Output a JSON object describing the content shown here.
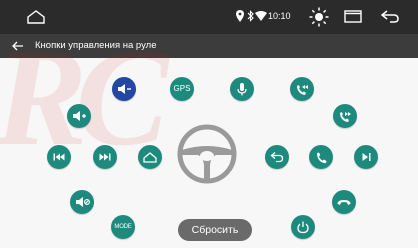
{
  "statusbar": {
    "time": "10:10"
  },
  "titlebar": {
    "title": "Кнопки управления на руле"
  },
  "buttons": {
    "gps_label": "GPS",
    "mode_label": "MODE"
  },
  "reset_label": "Сбросить",
  "watermark_text": "RC",
  "colors": {
    "teal": "#1e8a7d",
    "selected_blue": "#2347a2",
    "status_bar": "#2b2b2b",
    "title_bar": "#3c3c3c"
  },
  "icons": [
    "home-icon",
    "location-icon",
    "bluetooth-icon",
    "wifi-icon",
    "brightness-icon",
    "window-icon",
    "return-icon",
    "back-arrow-icon",
    "volume-down-icon",
    "volume-up-icon",
    "gps-icon",
    "mic-icon",
    "call-prev-icon",
    "call-next-icon",
    "prev-track-icon",
    "next-track-icon",
    "home-outline-icon",
    "steering-wheel-icon",
    "back-icon",
    "phone-icon",
    "play-pause-icon",
    "mute-icon",
    "hang-up-icon",
    "power-icon"
  ]
}
